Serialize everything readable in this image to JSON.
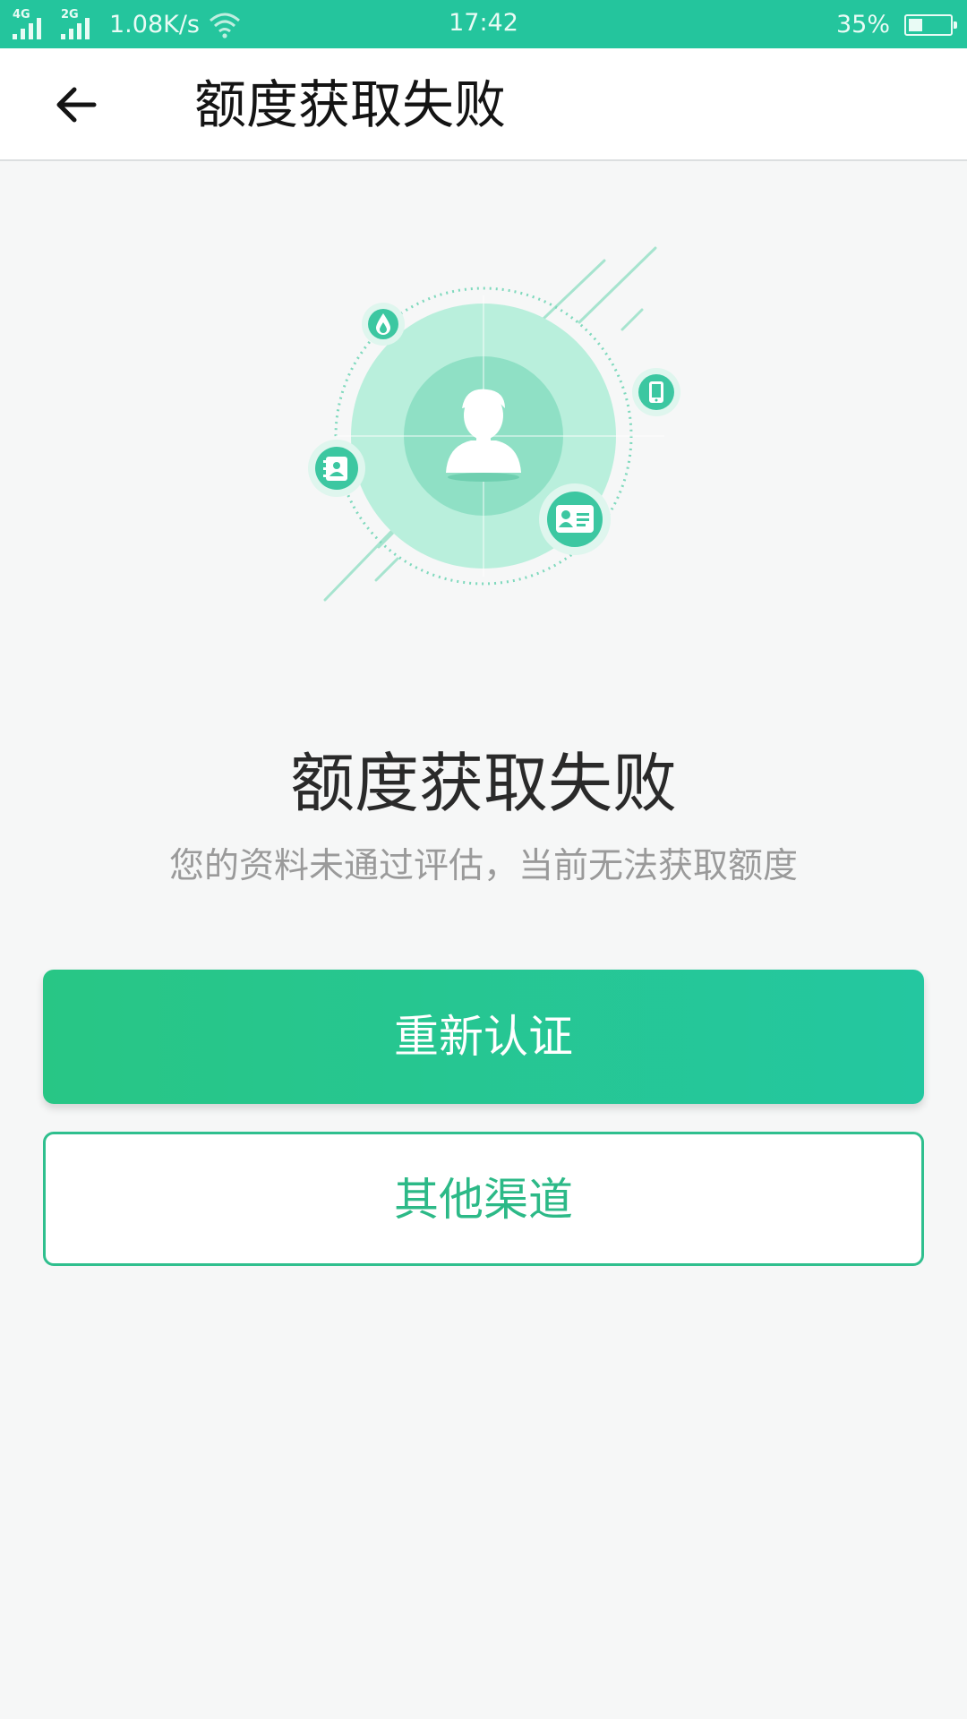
{
  "status_bar": {
    "signal1_label": "4G",
    "signal2_label": "2G",
    "net_speed": "1.08K/s",
    "time": "17:42",
    "battery": "35%",
    "battery_level": 0.35
  },
  "header": {
    "back_icon": "arrow-left-icon",
    "title": "额度获取失败"
  },
  "result": {
    "illustration_icons": [
      "user-avatar-icon",
      "water-drop-icon",
      "phone-icon",
      "contacts-book-icon",
      "id-card-icon"
    ],
    "title": "额度获取失败",
    "description": "您的资料未通过评估，当前无法获取额度"
  },
  "actions": {
    "primary_label": "重新认证",
    "secondary_label": "其他渠道"
  },
  "colors": {
    "accent": "#24c59d",
    "primary_button": "#27c691",
    "secondary_border": "#2fbf8e",
    "background": "#f6f7f7"
  }
}
